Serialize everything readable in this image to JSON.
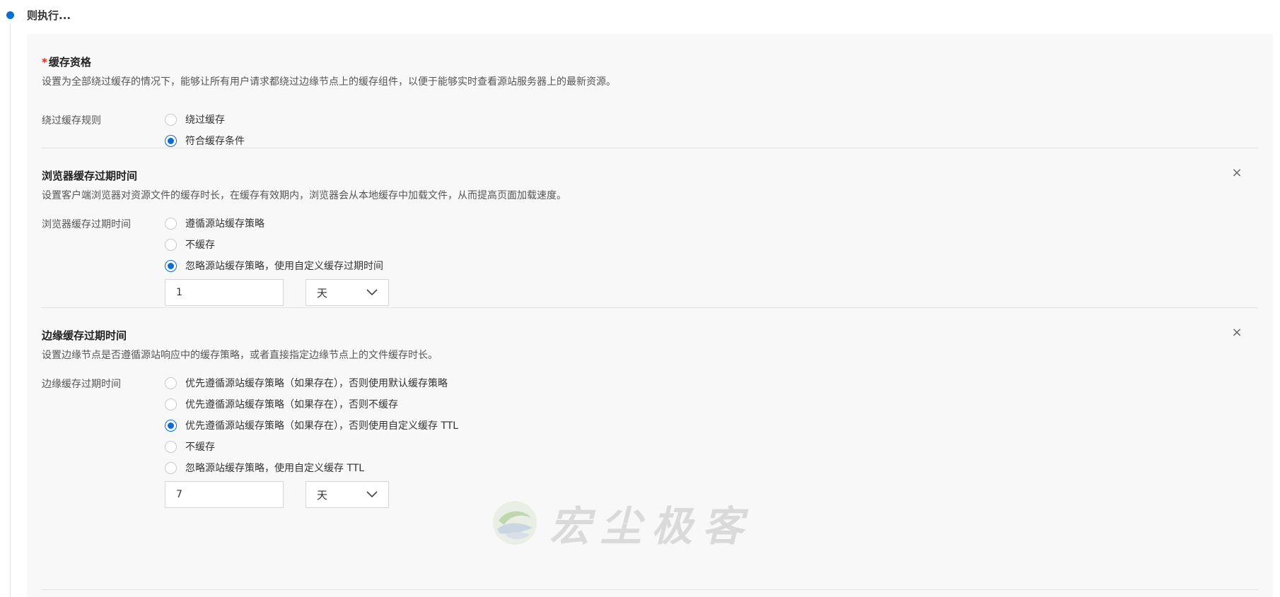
{
  "step": {
    "title": "则执行..."
  },
  "cache_eligibility": {
    "title": "缓存资格",
    "required_mark": "*",
    "description": "设置为全部绕过缓存的情况下，能够让所有用户请求都绕过边缘节点上的缓存组件，以便于能够实时查看源站服务器上的最新资源。",
    "field_label": "绕过缓存规则",
    "options": [
      {
        "label": "绕过缓存",
        "checked": false
      },
      {
        "label": "符合缓存条件",
        "checked": true
      }
    ]
  },
  "browser_cache": {
    "title": "浏览器缓存过期时间",
    "description": "设置客户端浏览器对资源文件的缓存时长，在缓存有效期内，浏览器会从本地缓存中加载文件，从而提高页面加载速度。",
    "field_label": "浏览器缓存过期时间",
    "close": "×",
    "options": [
      {
        "label": "遵循源站缓存策略",
        "checked": false
      },
      {
        "label": "不缓存",
        "checked": false
      },
      {
        "label": "忽略源站缓存策略，使用自定义缓存过期时间",
        "checked": true
      }
    ],
    "ttl_value": "1",
    "ttl_unit": "天"
  },
  "edge_cache": {
    "title": "边缘缓存过期时间",
    "description": "设置边缘节点是否遵循源站响应中的缓存策略，或者直接指定边缘节点上的文件缓存时长。",
    "field_label": "边缘缓存过期时间",
    "close": "×",
    "options": [
      {
        "label": "优先遵循源站缓存策略（如果存在），否则使用默认缓存策略",
        "checked": false
      },
      {
        "label": "优先遵循源站缓存策略（如果存在），否则不缓存",
        "checked": false
      },
      {
        "label": "优先遵循源站缓存策略（如果存在），否则使用自定义缓存 TTL",
        "checked": true
      },
      {
        "label": "不缓存",
        "checked": false
      },
      {
        "label": "忽略源站缓存策略，使用自定义缓存 TTL",
        "checked": false
      }
    ],
    "ttl_value": "7",
    "ttl_unit": "天"
  },
  "watermark": {
    "text": "宏尘极客"
  },
  "colors": {
    "accent": "#0a6ed1",
    "required": "#e0281d",
    "panel_bg": "#f8f8f8"
  }
}
